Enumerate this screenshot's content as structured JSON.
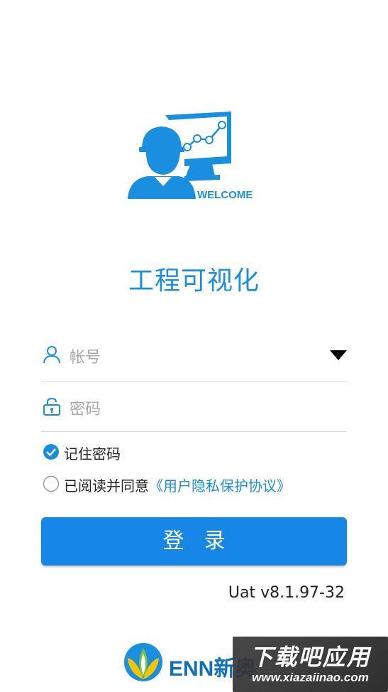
{
  "hero": {
    "welcome_text": "WELCOME",
    "accent_color": "#1a8fe0"
  },
  "app_title": "工程可视化",
  "login_form": {
    "account_placeholder": "帐号",
    "account_icon": "user-icon",
    "password_placeholder": "密码",
    "password_icon": "lock-icon",
    "dropdown_icon": "dropdown-triangle-icon",
    "remember_label": "记住密码",
    "remember_checked": true,
    "agree_label": "已阅读并同意",
    "agreement_link": "《用户隐私保护协议》",
    "agree_checked": false,
    "login_button": "登录"
  },
  "version": "Uat v8.1.97-32",
  "footer": {
    "brand_text": "ENN新奥",
    "brand_color": "#0f6fb8"
  },
  "watermark": {
    "title": "下载吧应用",
    "url": "www.xiazaiinao.com"
  }
}
